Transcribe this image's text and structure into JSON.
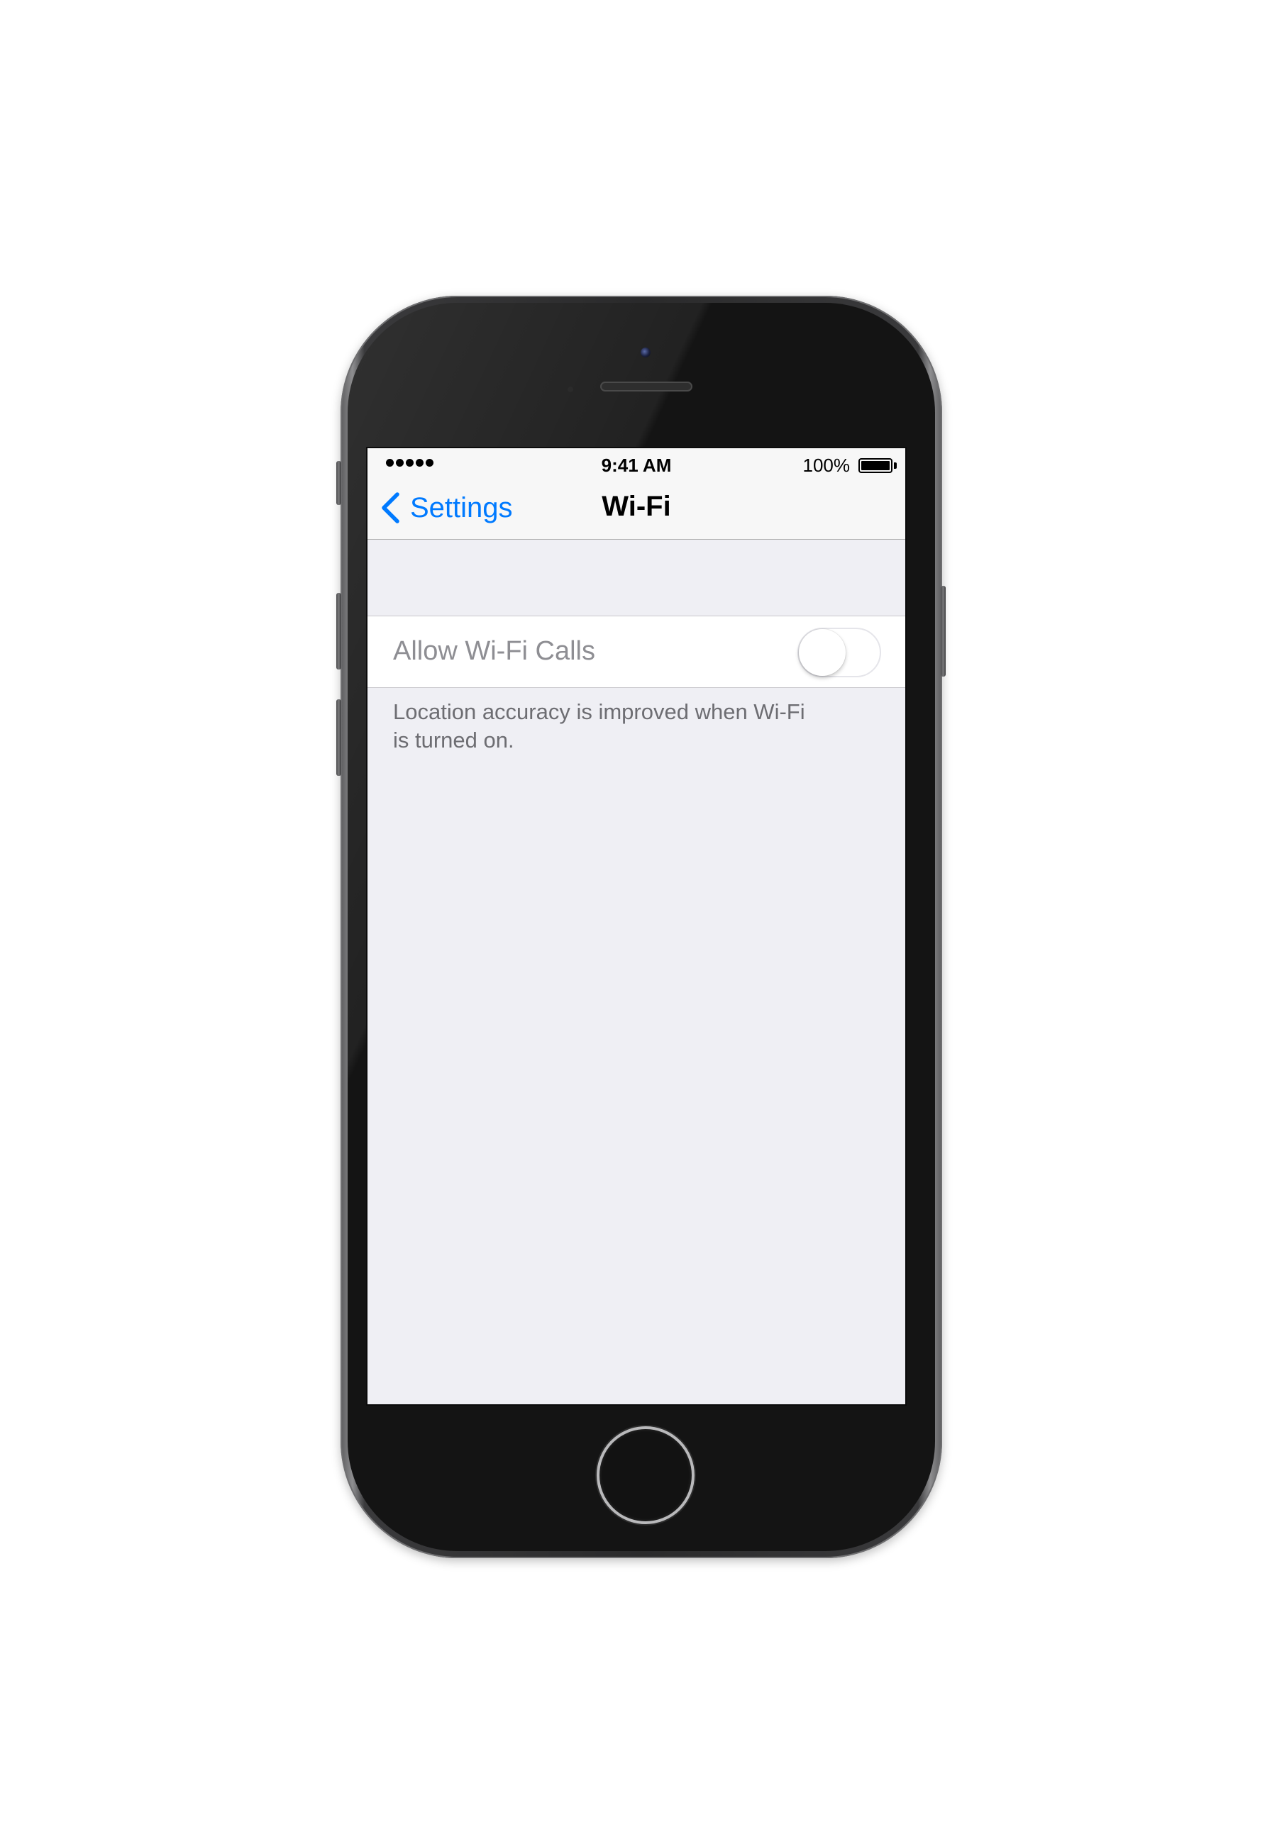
{
  "status_bar": {
    "signal_dots": 5,
    "time": "9:41 AM",
    "battery_percent": "100%",
    "battery_level": 1.0
  },
  "nav": {
    "back_label": "Settings",
    "title": "Wi-Fi"
  },
  "settings": {
    "toggle_label": "Allow Wi-Fi Calls",
    "toggle_on": false,
    "footer": "Location accuracy is improved when Wi-Fi is turned on."
  },
  "colors": {
    "accent": "#007aff",
    "screen_background": "#efeff4",
    "bar_background": "#f7f7f7",
    "secondary_text": "#8e8e93"
  },
  "icons": {
    "back": "chevron-left-icon",
    "battery": "battery-icon",
    "signal": "signal-dots-icon"
  }
}
